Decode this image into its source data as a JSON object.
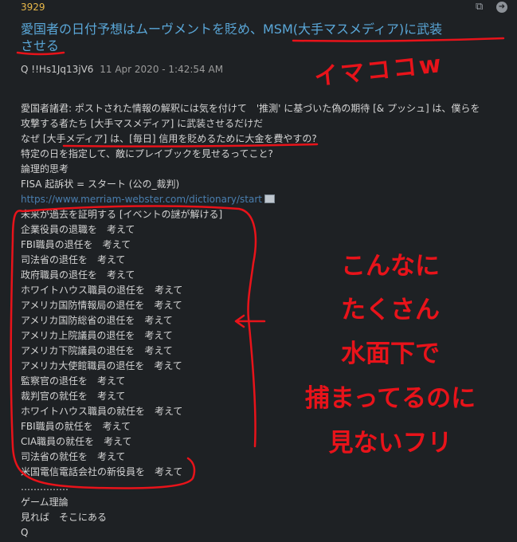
{
  "post": {
    "number": "3929",
    "title": "愛国者の日付予想はムーヴメントを貶め、MSM(大手マスメディア)に武装させる",
    "title_line1": "愛国者の日付予想はムーヴメントを貶め、MSM(大手マスメディア)に武装",
    "title_line2": "させる",
    "author": "Q",
    "tripcode": "!!Hs1Jq13jV6",
    "timestamp": "11 Apr 2020 - 1:42:54 AM",
    "icons": [
      "share-icon",
      "next-arrow-icon"
    ]
  },
  "body_lines": [
    "愛国者諸君: ポストされた情報の解釈には気を付けて　'推測' に基づいた偽の期待 [& プッシュ] は、僕らを",
    "攻撃する者たち [大手マスメディア] に武装させるだけだ",
    "なぜ [大手メディア] は、[毎日] 信用を貶めるために大金を費やすの?",
    "特定の日を指定して、敵にプレイブックを見せるってこと?",
    "論理的思考",
    "FISA 起訴状 = スタート (公の_裁判)",
    "https://www.merriam-webster.com/dictionary/start",
    "未来が過去を証明する [イベントの謎が解ける]",
    "企業役員の退職を　考えて",
    "FBI職員の退任を　考えて",
    "司法省の退任を　考えて",
    "政府職員の退任を　考えて",
    "ホワイトハウス職員の退任を　考えて",
    "アメリカ国防情報局の退任を　考えて",
    "アメリカ国防総省の退任を　考えて",
    "アメリカ上院議員の退任を　考えて",
    "アメリカ下院議員の退任を　考えて",
    "アメリカ大使館職員の退任を　考えて",
    "監察官の退任を　考えて",
    "裁判官の就任を　考えて",
    "ホワイトハウス職員の就任を　考えて",
    "FBI職員の就任を　考えて",
    "CIA職員の就任を　考えて",
    "司法省の就任を　考えて",
    "米国電信電話会社の新役員を　考えて",
    "……………",
    "ゲーム理論",
    "見れば　そこにある",
    "Q"
  ],
  "annotations": {
    "imakoko": "イマココw",
    "note_lines": [
      "こんなに",
      "たくさん",
      "水面下で",
      "捕まってるのに",
      "見ないフリ"
    ],
    "color": "#e8131a"
  },
  "colors": {
    "background": "#1e2124",
    "title": "#5aa7d8",
    "post_number": "#e8b84a",
    "link": "#4a7fb0"
  }
}
